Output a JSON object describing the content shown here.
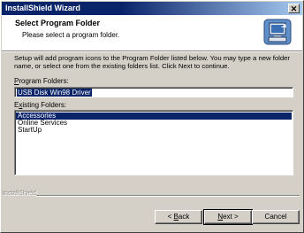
{
  "window": {
    "title": "InstallShield Wizard",
    "close_glyph": "✕"
  },
  "header": {
    "heading": "Select Program Folder",
    "subtitle": "Please select a program folder.",
    "icon": "installer-computer-icon"
  },
  "description": "Setup will add program icons to the Program Folder listed below. You may type a new folder name, or select one from the existing folders list. Click Next to continue.",
  "program_folder": {
    "label_prefix": "",
    "label_mnemonic": "P",
    "label_rest": "rogram Folders:",
    "value": "USB Disk Win98 Driver"
  },
  "existing_folders": {
    "label_prefix": "E",
    "label_mnemonic": "x",
    "label_rest": "isting Folders:",
    "items": [
      "Accessories",
      "Online Services",
      "StartUp"
    ],
    "selected_index": 0
  },
  "footer": {
    "brand": "InstallShield"
  },
  "buttons": {
    "back_prefix": "< ",
    "back_mnemonic": "B",
    "back_rest": "ack",
    "next_mnemonic": "N",
    "next_rest": "ext >",
    "cancel": "Cancel"
  },
  "colors": {
    "title_active": "#0a246a",
    "selection": "#0a246a",
    "face": "#d4d0c8"
  }
}
